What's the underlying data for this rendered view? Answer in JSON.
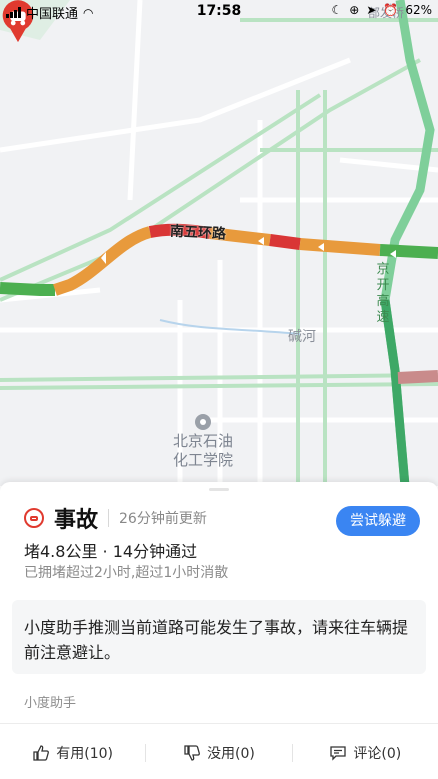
{
  "status_bar": {
    "carrier": "中国联通",
    "time": "17:58",
    "battery_text": "62%"
  },
  "map": {
    "road_name": "南五环路",
    "expressway_name": "京开高速",
    "river_name": "碱河",
    "poi_name": "北京石油化工学院",
    "corner_text": "部发桥",
    "traffic_colors": {
      "smooth": "#4caf50",
      "slow": "#e89a3c",
      "jam": "#d93636",
      "severe": "#a52a2a"
    }
  },
  "card": {
    "title": "事故",
    "updated": "26分钟前更新",
    "avoid_button": "尝试躲避",
    "summary": "堵4.8公里 · 14分钟通过",
    "duration_note": "已拥堵超过2小时,超过1小时消散",
    "message": "小度助手推测当前道路可能发生了事故，请来往车辆提前注意避让。",
    "source": "小度助手",
    "accent": "#e03a2f",
    "button_color": "#3a85f2"
  },
  "actions": [
    {
      "label": "有用(10)",
      "icon": "thumbs-up-icon"
    },
    {
      "label": "没用(0)",
      "icon": "thumbs-down-icon"
    },
    {
      "label": "评论(0)",
      "icon": "comment-icon"
    }
  ]
}
